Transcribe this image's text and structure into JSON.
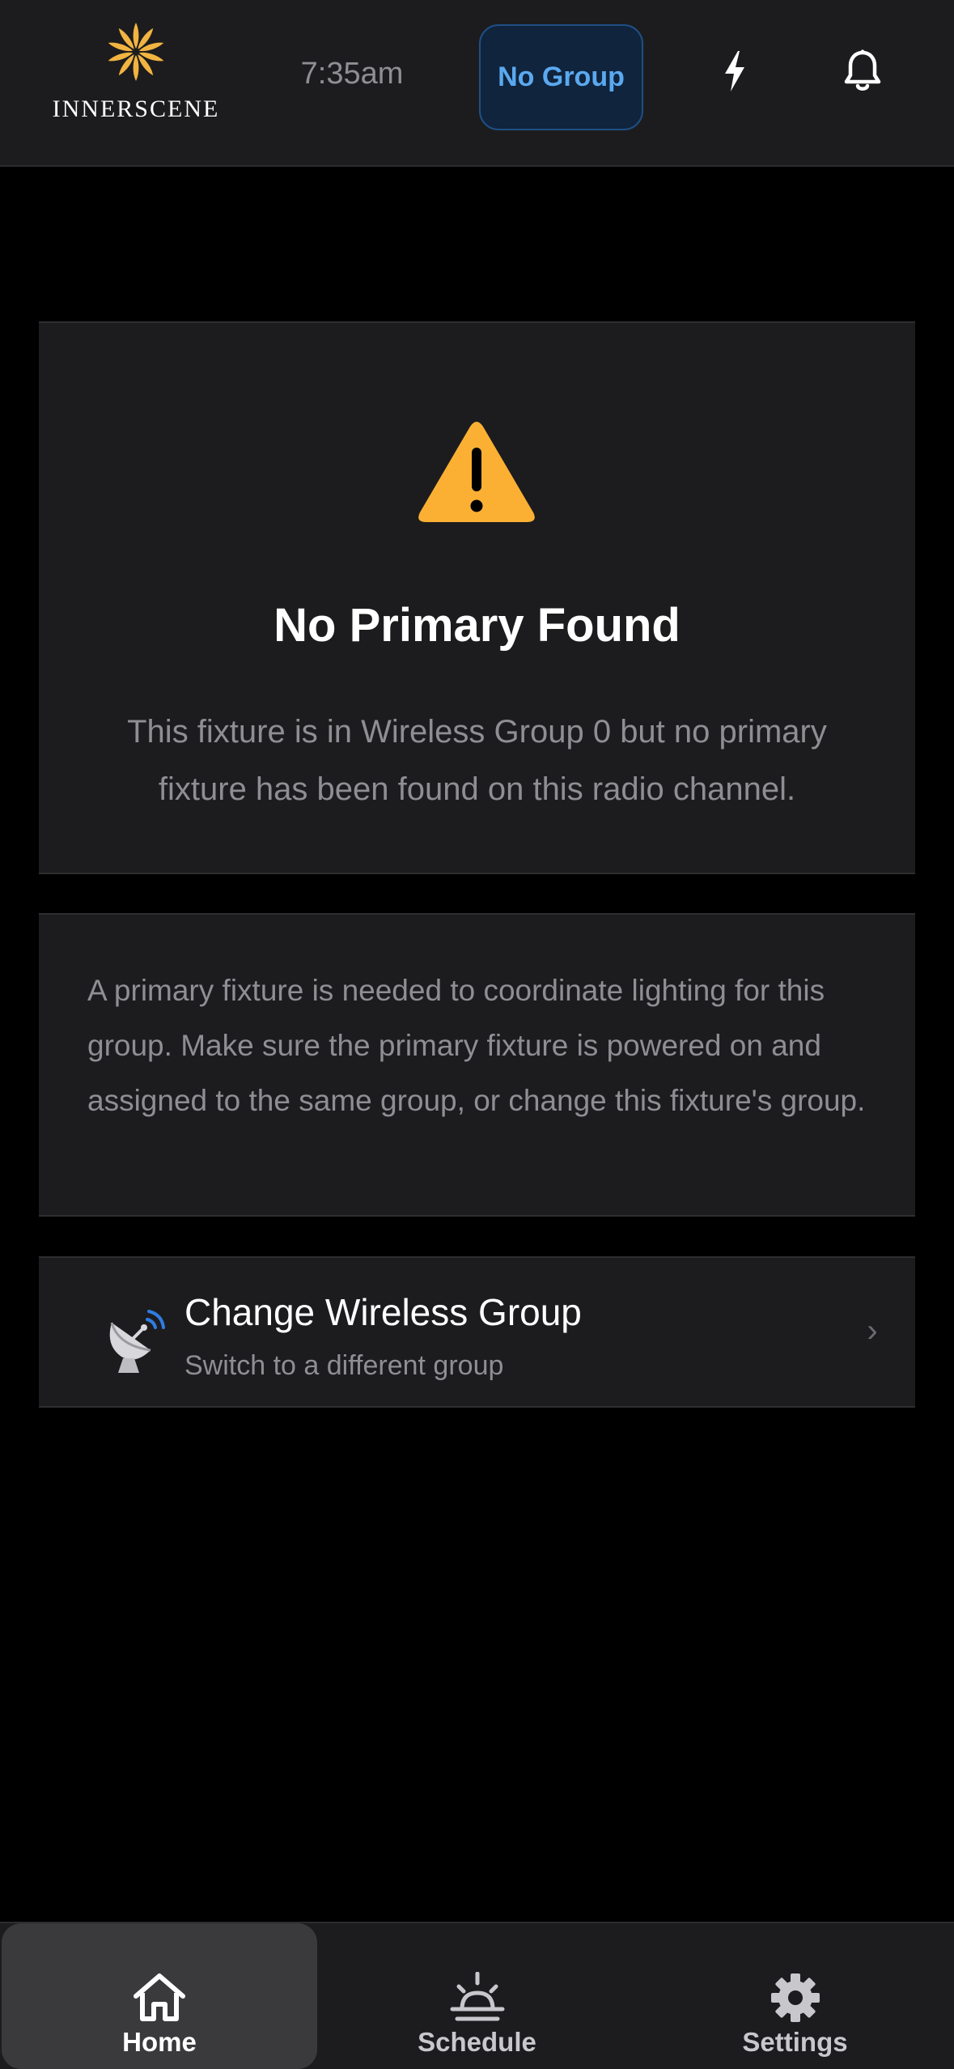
{
  "header": {
    "logo_text": "INNERSCENE",
    "time": "7:35am",
    "group_pill": "No Group",
    "icons": {
      "power": "bolt-icon",
      "notifications": "bell-icon"
    }
  },
  "warning_card": {
    "icon": "warning-triangle-icon",
    "title": "No Primary Found",
    "message": "This fixture is in Wireless Group 0 but no primary fixture has been found on this radio channel."
  },
  "info_card": {
    "text": "A primary fixture is needed to coordinate lighting for this group. Make sure the primary fixture is powered on and assigned to the same group, or change this fixture's group."
  },
  "action_card": {
    "icon": "satellite-dish-icon",
    "title": "Change Wireless Group",
    "subtitle": "Switch to a different group",
    "chevron": "›"
  },
  "bottom_nav": {
    "items": [
      {
        "label": "Home",
        "icon": "home-icon",
        "active": true
      },
      {
        "label": "Schedule",
        "icon": "sunrise-icon",
        "active": false
      },
      {
        "label": "Settings",
        "icon": "gear-icon",
        "active": false
      }
    ]
  },
  "colors": {
    "background": "#000000",
    "surface": "#1c1c1e",
    "accent_blue": "#5aa9f0",
    "warning_yellow": "#fbb034",
    "logo_gold": "#f2b441",
    "secondary_text": "#8e8e93"
  }
}
